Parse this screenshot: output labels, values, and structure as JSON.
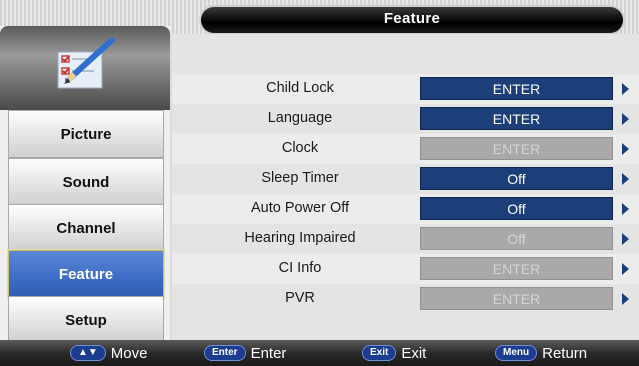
{
  "header": {
    "title": "Feature"
  },
  "sidebar": {
    "items": [
      {
        "label": "Picture",
        "active": false
      },
      {
        "label": "Sound",
        "active": false
      },
      {
        "label": "Channel",
        "active": false
      },
      {
        "label": "Feature",
        "active": true
      },
      {
        "label": "Setup",
        "active": false
      }
    ]
  },
  "settings": [
    {
      "label": "Child Lock",
      "value": "ENTER",
      "enabled": true
    },
    {
      "label": "Language",
      "value": "ENTER",
      "enabled": true
    },
    {
      "label": "Clock",
      "value": "ENTER",
      "enabled": false
    },
    {
      "label": "Sleep Timer",
      "value": "Off",
      "enabled": true
    },
    {
      "label": "Auto Power Off",
      "value": "Off",
      "enabled": true
    },
    {
      "label": "Hearing Impaired",
      "value": "Off",
      "enabled": false
    },
    {
      "label": "CI Info",
      "value": "ENTER",
      "enabled": false
    },
    {
      "label": "PVR",
      "value": "ENTER",
      "enabled": false
    }
  ],
  "footer": {
    "hints": [
      {
        "key": "▲▼",
        "label": "Move"
      },
      {
        "key": "Enter",
        "label": "Enter"
      },
      {
        "key": "Exit",
        "label": "Exit"
      },
      {
        "key": "Menu",
        "label": "Return"
      }
    ]
  },
  "colors": {
    "accent_blue": "#1c3f7a",
    "disabled_gray": "#a9a9a9",
    "active_nav": "#3d6cc5"
  }
}
